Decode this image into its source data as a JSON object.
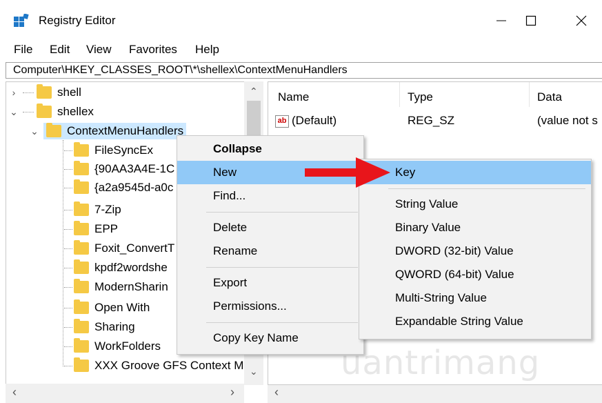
{
  "window": {
    "title": "Registry Editor"
  },
  "menu": [
    "File",
    "Edit",
    "View",
    "Favorites",
    "Help"
  ],
  "address": "Computer\\HKEY_CLASSES_ROOT\\*\\shellex\\ContextMenuHandlers",
  "tree": {
    "shell": "shell",
    "shellex": "shellex",
    "context_menu_handlers": "ContextMenuHandlers",
    "children": [
      "FileSyncEx",
      "{90AA3A4E-1C",
      "{a2a9545d-a0c",
      "7-Zip",
      "EPP",
      "Foxit_ConvertT",
      "kpdf2wordshe",
      "ModernSharin",
      "Open With",
      "Sharing",
      "WorkFolders",
      "XXX Groove GFS Context M"
    ]
  },
  "list": {
    "columns": [
      "Name",
      "Type",
      "Data"
    ],
    "rows": [
      {
        "name": "(Default)",
        "type": "REG_SZ",
        "data": "(value not s"
      }
    ]
  },
  "context_menu": {
    "items": [
      "Collapse",
      "New",
      "Find...",
      "Delete",
      "Rename",
      "Export",
      "Permissions...",
      "Copy Key Name"
    ],
    "highlighted": "New"
  },
  "submenu": {
    "items": [
      "Key",
      "String Value",
      "Binary Value",
      "DWORD (32-bit) Value",
      "QWORD (64-bit) Value",
      "Multi-String Value",
      "Expandable String Value"
    ],
    "highlighted": "Key"
  },
  "watermark": "uantrimang",
  "colors": {
    "selection": "#cce8ff",
    "menu_highlight": "#91c9f7",
    "arrow": "#e8151b",
    "folder": "#f5c945"
  },
  "icons": [
    "registry-app-icon",
    "minimize-icon",
    "maximize-icon",
    "close-icon",
    "folder-icon",
    "string-value-icon",
    "red-arrow-icon"
  ]
}
